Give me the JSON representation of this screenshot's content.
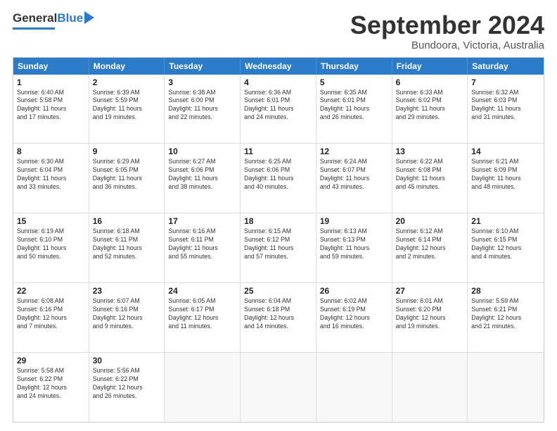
{
  "header": {
    "logo_general": "General",
    "logo_blue": "Blue",
    "month_title": "September 2024",
    "location": "Bundoora, Victoria, Australia"
  },
  "calendar": {
    "days_of_week": [
      "Sunday",
      "Monday",
      "Tuesday",
      "Wednesday",
      "Thursday",
      "Friday",
      "Saturday"
    ],
    "rows": [
      [
        {
          "day": "1",
          "info": "Sunrise: 6:40 AM\nSunset: 5:58 PM\nDaylight: 11 hours\nand 17 minutes."
        },
        {
          "day": "2",
          "info": "Sunrise: 6:39 AM\nSunset: 5:59 PM\nDaylight: 11 hours\nand 19 minutes."
        },
        {
          "day": "3",
          "info": "Sunrise: 6:38 AM\nSunset: 6:00 PM\nDaylight: 11 hours\nand 22 minutes."
        },
        {
          "day": "4",
          "info": "Sunrise: 6:36 AM\nSunset: 6:01 PM\nDaylight: 11 hours\nand 24 minutes."
        },
        {
          "day": "5",
          "info": "Sunrise: 6:35 AM\nSunset: 6:01 PM\nDaylight: 11 hours\nand 26 minutes."
        },
        {
          "day": "6",
          "info": "Sunrise: 6:33 AM\nSunset: 6:02 PM\nDaylight: 11 hours\nand 29 minutes."
        },
        {
          "day": "7",
          "info": "Sunrise: 6:32 AM\nSunset: 6:03 PM\nDaylight: 11 hours\nand 31 minutes."
        }
      ],
      [
        {
          "day": "8",
          "info": "Sunrise: 6:30 AM\nSunset: 6:04 PM\nDaylight: 11 hours\nand 33 minutes."
        },
        {
          "day": "9",
          "info": "Sunrise: 6:29 AM\nSunset: 6:05 PM\nDaylight: 11 hours\nand 36 minutes."
        },
        {
          "day": "10",
          "info": "Sunrise: 6:27 AM\nSunset: 6:06 PM\nDaylight: 11 hours\nand 38 minutes."
        },
        {
          "day": "11",
          "info": "Sunrise: 6:25 AM\nSunset: 6:06 PM\nDaylight: 11 hours\nand 40 minutes."
        },
        {
          "day": "12",
          "info": "Sunrise: 6:24 AM\nSunset: 6:07 PM\nDaylight: 11 hours\nand 43 minutes."
        },
        {
          "day": "13",
          "info": "Sunrise: 6:22 AM\nSunset: 6:08 PM\nDaylight: 11 hours\nand 45 minutes."
        },
        {
          "day": "14",
          "info": "Sunrise: 6:21 AM\nSunset: 6:09 PM\nDaylight: 11 hours\nand 48 minutes."
        }
      ],
      [
        {
          "day": "15",
          "info": "Sunrise: 6:19 AM\nSunset: 6:10 PM\nDaylight: 11 hours\nand 50 minutes."
        },
        {
          "day": "16",
          "info": "Sunrise: 6:18 AM\nSunset: 6:11 PM\nDaylight: 11 hours\nand 52 minutes."
        },
        {
          "day": "17",
          "info": "Sunrise: 6:16 AM\nSunset: 6:11 PM\nDaylight: 11 hours\nand 55 minutes."
        },
        {
          "day": "18",
          "info": "Sunrise: 6:15 AM\nSunset: 6:12 PM\nDaylight: 11 hours\nand 57 minutes."
        },
        {
          "day": "19",
          "info": "Sunrise: 6:13 AM\nSunset: 6:13 PM\nDaylight: 11 hours\nand 59 minutes."
        },
        {
          "day": "20",
          "info": "Sunrise: 6:12 AM\nSunset: 6:14 PM\nDaylight: 12 hours\nand 2 minutes."
        },
        {
          "day": "21",
          "info": "Sunrise: 6:10 AM\nSunset: 6:15 PM\nDaylight: 12 hours\nand 4 minutes."
        }
      ],
      [
        {
          "day": "22",
          "info": "Sunrise: 6:08 AM\nSunset: 6:16 PM\nDaylight: 12 hours\nand 7 minutes."
        },
        {
          "day": "23",
          "info": "Sunrise: 6:07 AM\nSunset: 6:16 PM\nDaylight: 12 hours\nand 9 minutes."
        },
        {
          "day": "24",
          "info": "Sunrise: 6:05 AM\nSunset: 6:17 PM\nDaylight: 12 hours\nand 11 minutes."
        },
        {
          "day": "25",
          "info": "Sunrise: 6:04 AM\nSunset: 6:18 PM\nDaylight: 12 hours\nand 14 minutes."
        },
        {
          "day": "26",
          "info": "Sunrise: 6:02 AM\nSunset: 6:19 PM\nDaylight: 12 hours\nand 16 minutes."
        },
        {
          "day": "27",
          "info": "Sunrise: 6:01 AM\nSunset: 6:20 PM\nDaylight: 12 hours\nand 19 minutes."
        },
        {
          "day": "28",
          "info": "Sunrise: 5:59 AM\nSunset: 6:21 PM\nDaylight: 12 hours\nand 21 minutes."
        }
      ],
      [
        {
          "day": "29",
          "info": "Sunrise: 5:58 AM\nSunset: 6:22 PM\nDaylight: 12 hours\nand 24 minutes."
        },
        {
          "day": "30",
          "info": "Sunrise: 5:56 AM\nSunset: 6:22 PM\nDaylight: 12 hours\nand 26 minutes."
        },
        {
          "day": "",
          "info": ""
        },
        {
          "day": "",
          "info": ""
        },
        {
          "day": "",
          "info": ""
        },
        {
          "day": "",
          "info": ""
        },
        {
          "day": "",
          "info": ""
        }
      ]
    ]
  }
}
